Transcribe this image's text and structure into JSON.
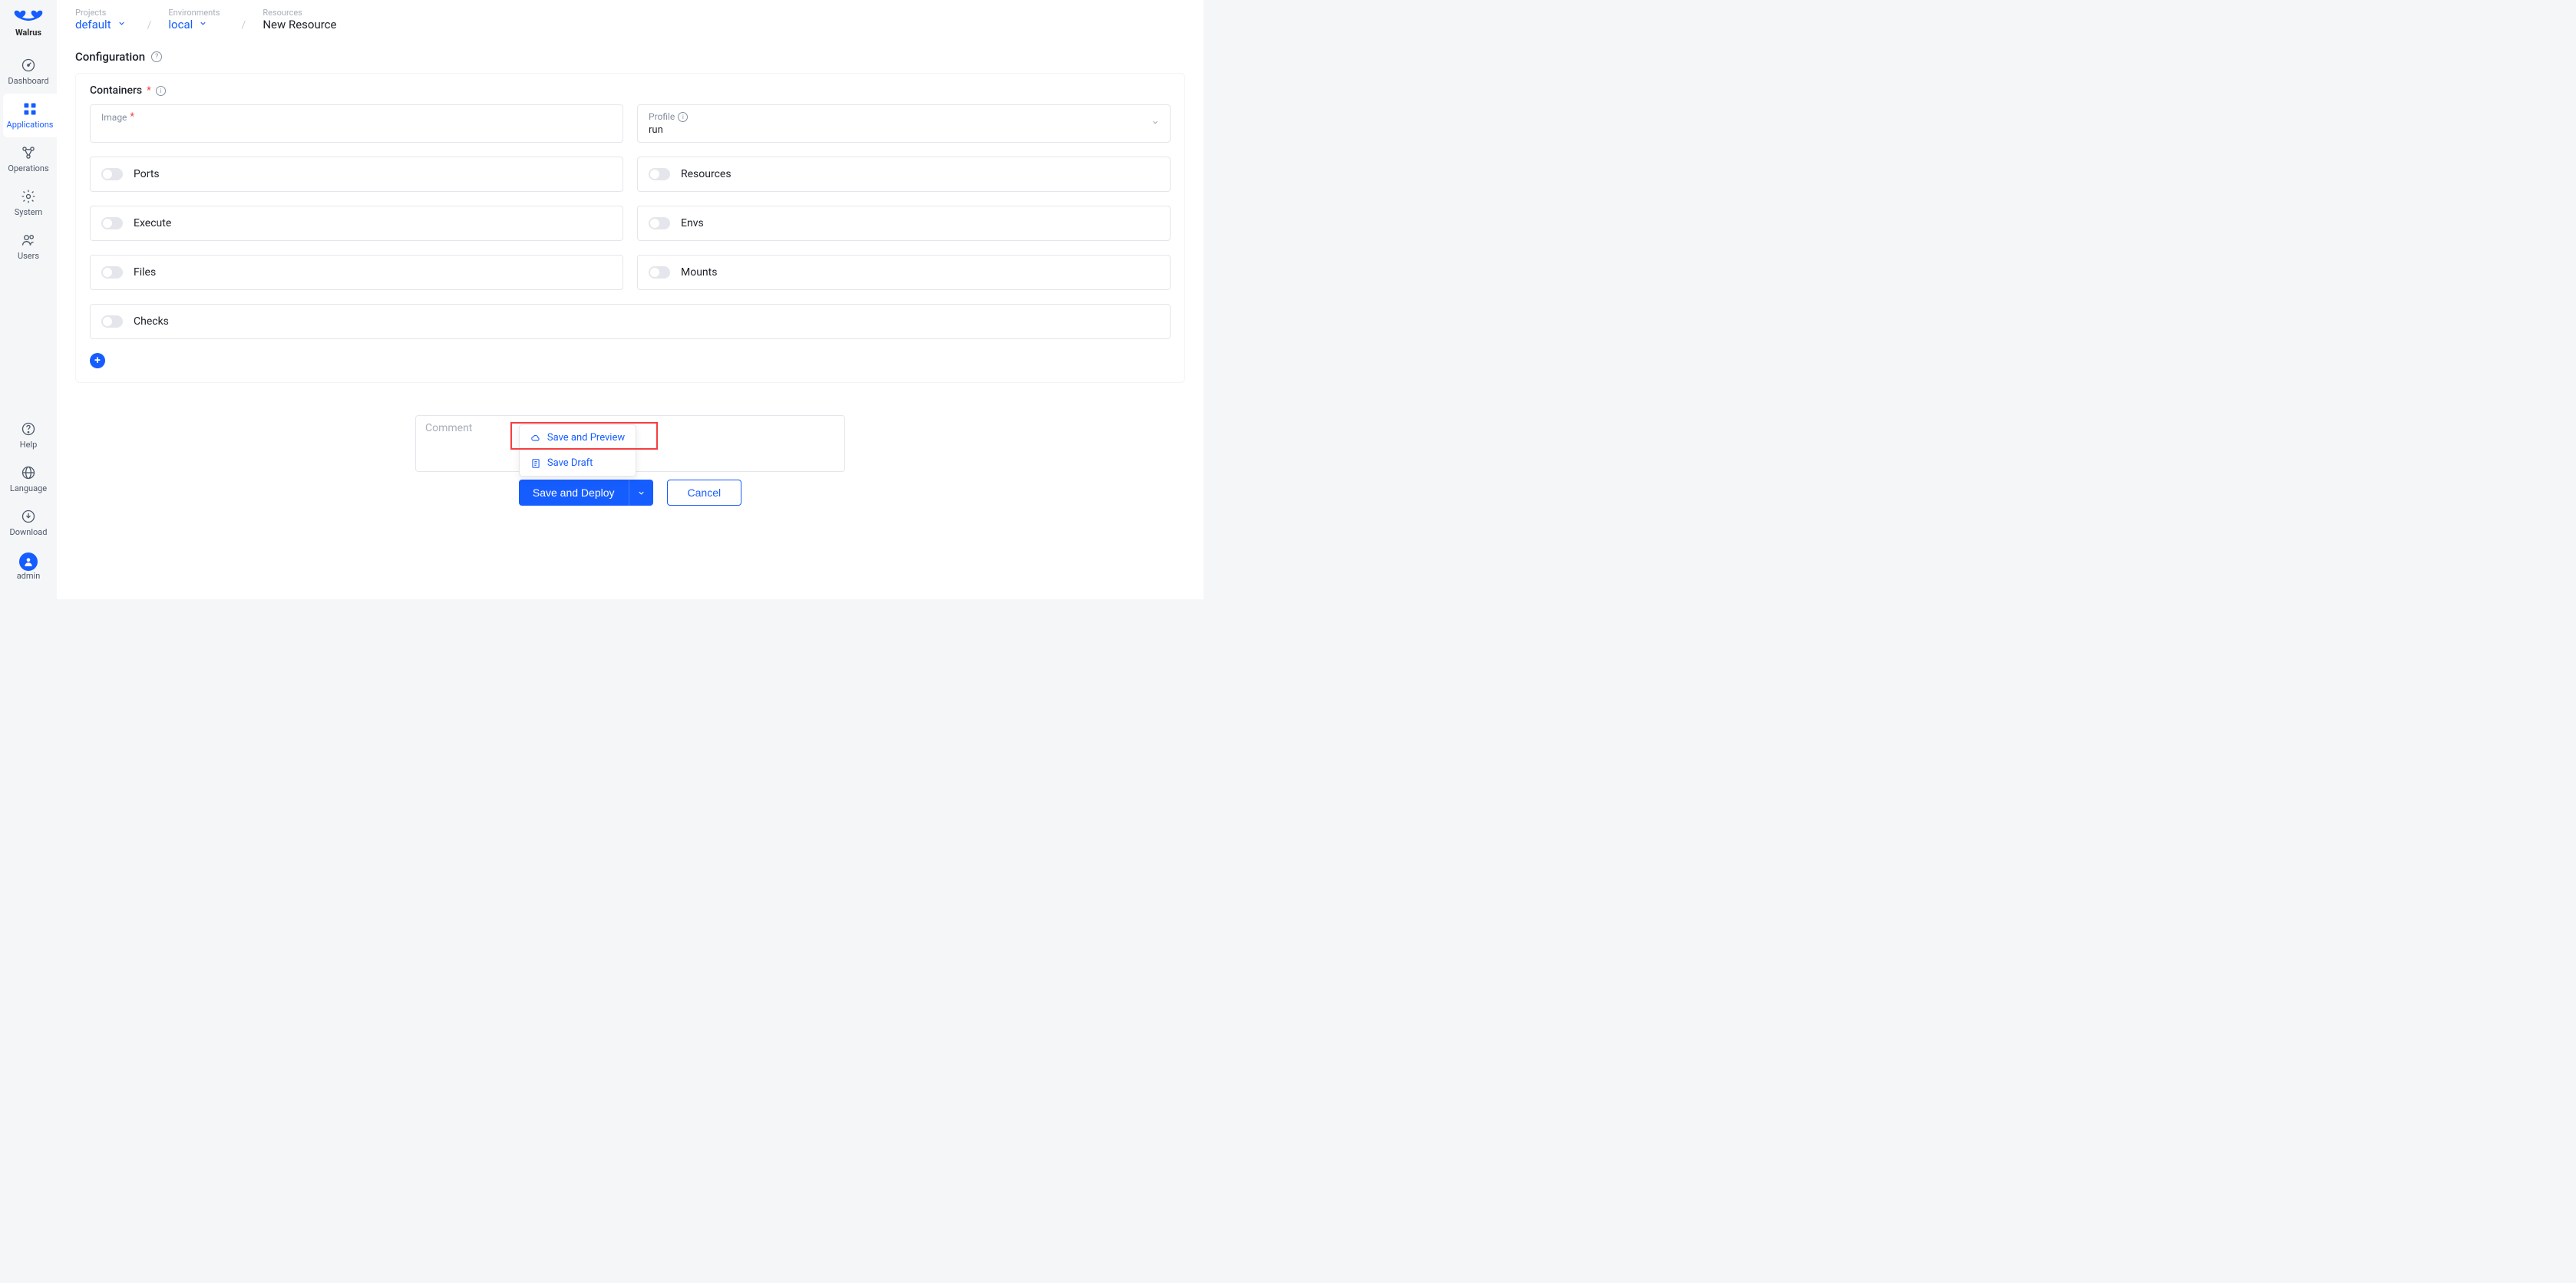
{
  "brand": {
    "name": "Walrus"
  },
  "sidebar": {
    "items": [
      {
        "label": "Dashboard"
      },
      {
        "label": "Applications"
      },
      {
        "label": "Operations"
      },
      {
        "label": "System"
      },
      {
        "label": "Users"
      }
    ],
    "bottom": [
      {
        "label": "Help"
      },
      {
        "label": "Language"
      },
      {
        "label": "Download"
      }
    ],
    "user": {
      "label": "admin"
    }
  },
  "breadcrumb": {
    "projects": {
      "title": "Projects",
      "value": "default"
    },
    "environments": {
      "title": "Environments",
      "value": "local"
    },
    "resources": {
      "title": "Resources",
      "value": "New Resource"
    }
  },
  "section": {
    "title": "Configuration"
  },
  "containers": {
    "title": "Containers",
    "image_label": "Image",
    "profile": {
      "label": "Profile",
      "value": "run"
    },
    "toggles": {
      "ports": "Ports",
      "resources": "Resources",
      "execute": "Execute",
      "envs": "Envs",
      "files": "Files",
      "mounts": "Mounts",
      "checks": "Checks"
    }
  },
  "footer": {
    "comment_placeholder": "Comment",
    "save_deploy": "Save and Deploy",
    "cancel": "Cancel",
    "dropdown": {
      "save_preview": "Save and Preview",
      "save_draft": "Save Draft"
    }
  }
}
